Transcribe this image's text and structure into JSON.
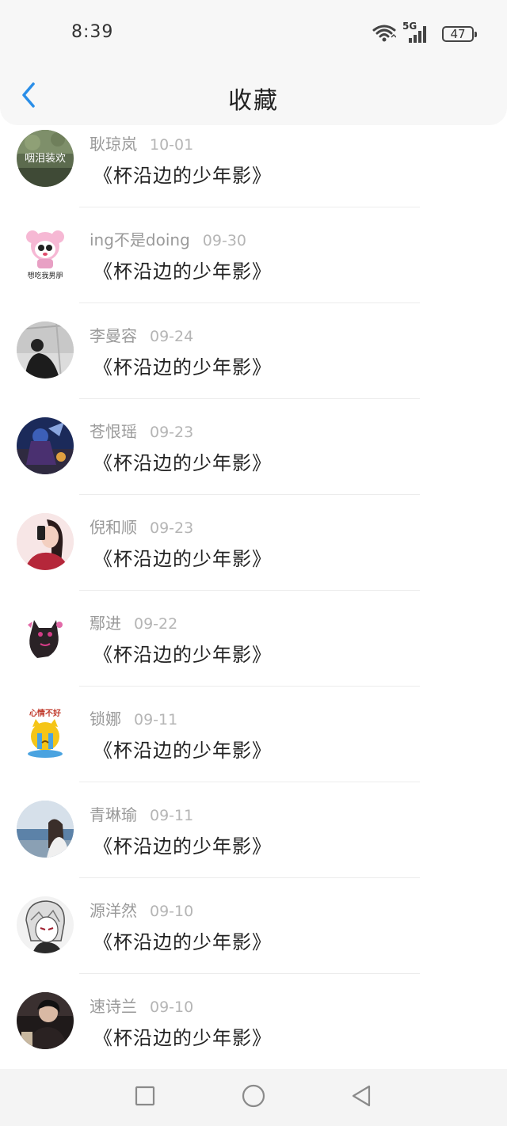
{
  "status_bar": {
    "time": "8:39",
    "network_label": "5G",
    "battery_level": "47",
    "icons": [
      "wifi-icon",
      "signal-5g-icon",
      "battery-icon"
    ]
  },
  "header": {
    "title": "收藏",
    "back_icon": "chevron-left-icon",
    "accent_color": "#2a8ee8"
  },
  "list": {
    "items": [
      {
        "name": "耿琼岚",
        "date": "10-01",
        "song": "《杯沿边的少年影》",
        "avatar_caption": "咽泪装欢"
      },
      {
        "name": "ing不是doing",
        "date": "09-30",
        "song": "《杯沿边的少年影》",
        "avatar_caption": "想吃我男朋"
      },
      {
        "name": "李曼容",
        "date": "09-24",
        "song": "《杯沿边的少年影》"
      },
      {
        "name": "苍恨瑶",
        "date": "09-23",
        "song": "《杯沿边的少年影》"
      },
      {
        "name": "倪和顺",
        "date": "09-23",
        "song": "《杯沿边的少年影》"
      },
      {
        "name": "鄢进",
        "date": "09-22",
        "song": "《杯沿边的少年影》"
      },
      {
        "name": "锁娜",
        "date": "09-11",
        "song": "《杯沿边的少年影》",
        "avatar_caption": "心情不好"
      },
      {
        "name": "青琳瑜",
        "date": "09-11",
        "song": "《杯沿边的少年影》"
      },
      {
        "name": "源洋然",
        "date": "09-10",
        "song": "《杯沿边的少年影》"
      },
      {
        "name": "速诗兰",
        "date": "09-10",
        "song": "《杯沿边的少年影》"
      }
    ]
  },
  "nav_bar": {
    "icons": [
      "square-icon",
      "circle-icon",
      "triangle-back-icon"
    ]
  }
}
